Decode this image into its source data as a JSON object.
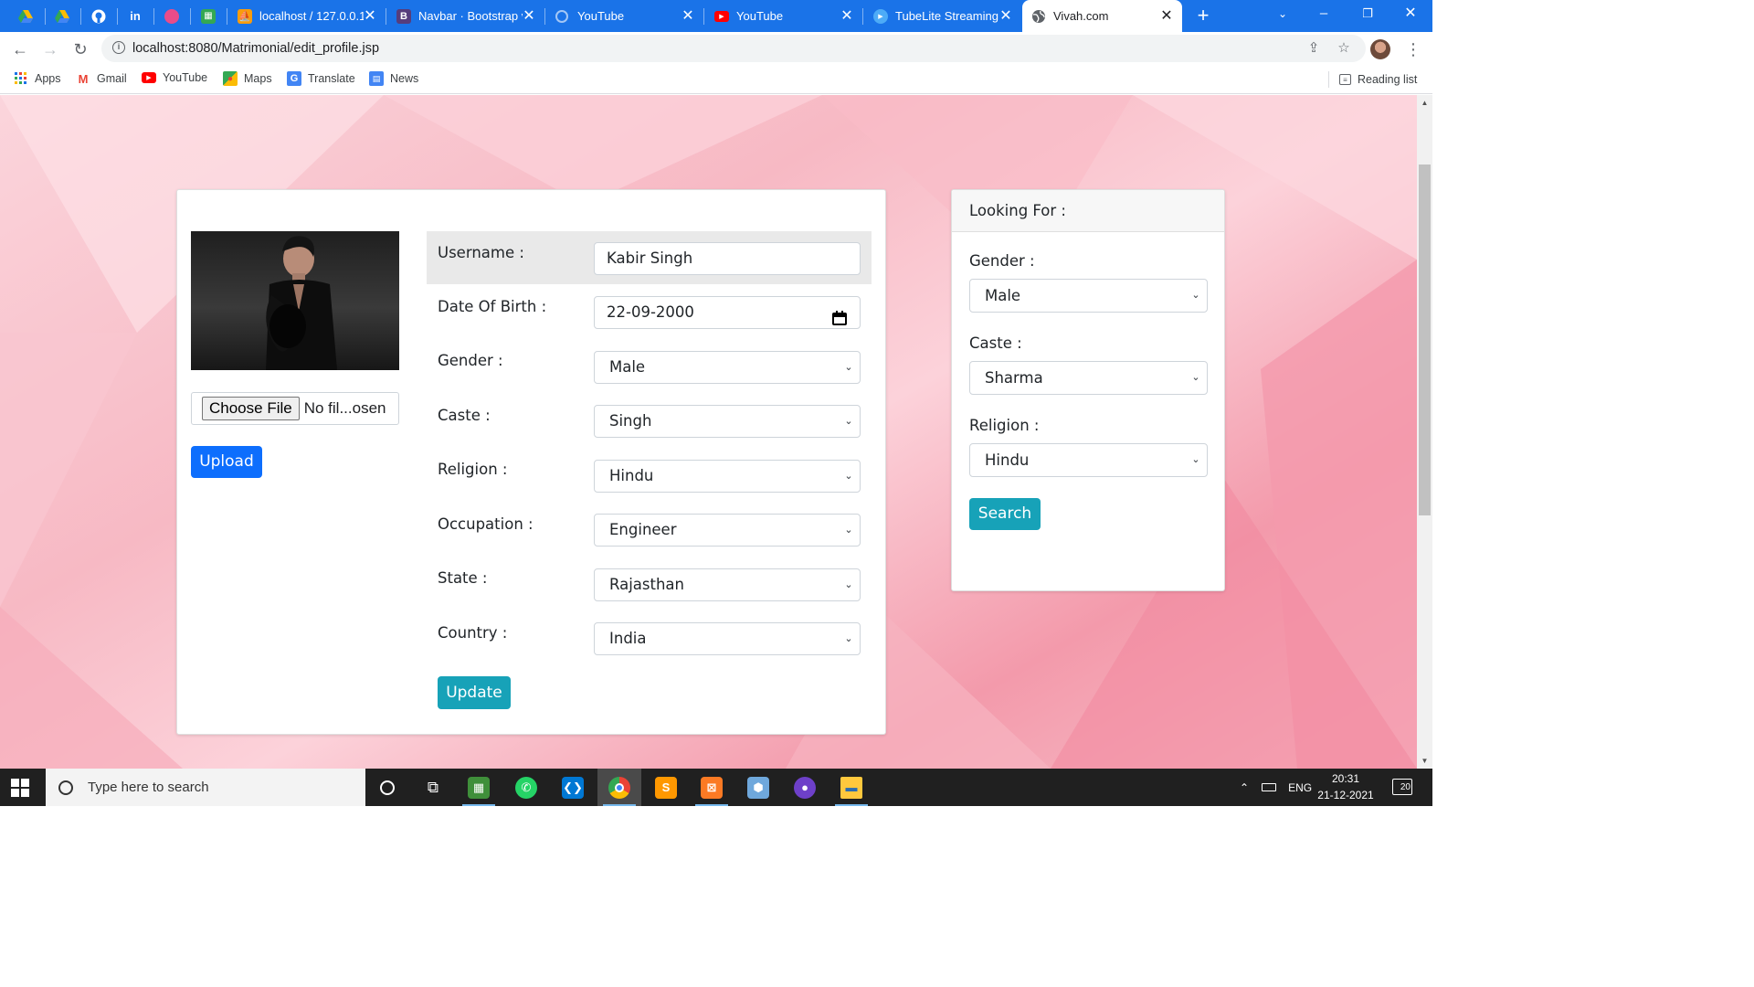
{
  "browser": {
    "pinned_tabs": [
      {
        "icon": "google-drive-icon"
      },
      {
        "icon": "google-drive-icon"
      },
      {
        "icon": "github-icon"
      },
      {
        "icon": "linkedin-icon",
        "label": "in"
      },
      {
        "icon": "dribbble-icon"
      },
      {
        "icon": "sheets-icon"
      }
    ],
    "tabs": [
      {
        "title": "localhost / 127.0.0.1",
        "icon": "phpmyadmin-icon"
      },
      {
        "title": "Navbar · Bootstrap v",
        "icon": "bootstrap-icon",
        "glyph": "B"
      },
      {
        "title": "YouTube",
        "icon": "loading-icon"
      },
      {
        "title": "YouTube",
        "icon": "youtube-icon"
      },
      {
        "title": "TubeLite Streaming",
        "icon": "play-icon"
      },
      {
        "title": "Vivah.com",
        "icon": "globe-icon",
        "active": true
      }
    ],
    "url": "localhost:8080/Matrimonial/edit_profile.jsp",
    "bookmarks": [
      {
        "label": "Apps",
        "icon": "apps-grid-icon"
      },
      {
        "label": "Gmail",
        "icon": "gmail-icon",
        "glyph": "M"
      },
      {
        "label": "YouTube",
        "icon": "youtube-icon"
      },
      {
        "label": "Maps",
        "icon": "maps-icon"
      },
      {
        "label": "Translate",
        "icon": "translate-icon",
        "glyph": "G"
      },
      {
        "label": "News",
        "icon": "news-icon"
      }
    ],
    "reading_list": "Reading list"
  },
  "profile": {
    "file_button": "Choose File",
    "file_status": "No fil...osen",
    "upload_label": "Upload",
    "fields": [
      {
        "label": "Username :",
        "value": "Kabir Singh",
        "kind": "text"
      },
      {
        "label": "Date Of Birth :",
        "value": "22-09-2000",
        "kind": "date"
      },
      {
        "label": "Gender :",
        "value": "Male",
        "kind": "select"
      },
      {
        "label": "Caste :",
        "value": "Singh",
        "kind": "select"
      },
      {
        "label": "Religion :",
        "value": "Hindu",
        "kind": "select"
      },
      {
        "label": "Occupation :",
        "value": "Engineer",
        "kind": "select"
      },
      {
        "label": "State :",
        "value": "Rajasthan",
        "kind": "select"
      },
      {
        "label": "Country :",
        "value": "India",
        "kind": "select"
      }
    ],
    "update_label": "Update"
  },
  "looking_for": {
    "title": "Looking For :",
    "fields": [
      {
        "label": "Gender :",
        "value": "Male"
      },
      {
        "label": "Caste :",
        "value": "Sharma"
      },
      {
        "label": "Religion :",
        "value": "Hindu"
      }
    ],
    "search_label": "Search"
  },
  "taskbar": {
    "search_placeholder": "Type here to search",
    "apps": [
      {
        "icon": "task-view-icon"
      },
      {
        "icon": "spreadsheet-app-icon"
      },
      {
        "icon": "whatsapp-icon"
      },
      {
        "icon": "vscode-icon"
      },
      {
        "icon": "chrome-icon",
        "active": true
      },
      {
        "icon": "sublime-text-icon"
      },
      {
        "icon": "xampp-icon"
      },
      {
        "icon": "virtualbox-icon"
      },
      {
        "icon": "github-desktop-icon"
      },
      {
        "icon": "file-explorer-icon"
      }
    ],
    "language": "ENG",
    "time": "20:31",
    "date": "21-12-2021",
    "notification_count": "20"
  },
  "colors": {
    "chrome_tabstrip": "#1a73e8",
    "primary_button": "#0d6efd",
    "info_button": "#17a2b8",
    "page_background": "#f7b9c4"
  }
}
